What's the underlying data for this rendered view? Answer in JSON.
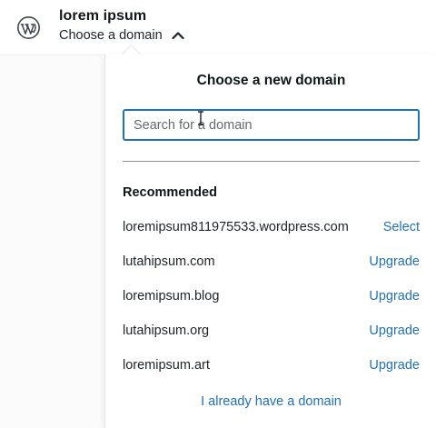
{
  "header": {
    "site_title": "lorem ipsum",
    "domain_switcher_label": "Choose a domain",
    "logo_icon": "wordpress-logo-icon",
    "chevron_icon": "chevron-up-icon"
  },
  "popover": {
    "title": "Choose a new domain",
    "search": {
      "placeholder": "Search for a domain",
      "value": ""
    },
    "recommended_heading": "Recommended",
    "domains": [
      {
        "name": "loremipsum811975533.wordpress.com",
        "action": "Select"
      },
      {
        "name": "lutahipsum.com",
        "action": "Upgrade"
      },
      {
        "name": "loremipsum.blog",
        "action": "Upgrade"
      },
      {
        "name": "lutahipsum.org",
        "action": "Upgrade"
      },
      {
        "name": "loremipsum.art",
        "action": "Upgrade"
      }
    ],
    "footer_link": "I already have a domain"
  },
  "colors": {
    "accent": "#2271b1",
    "text": "#1d2327",
    "logo": "#3c434a"
  }
}
